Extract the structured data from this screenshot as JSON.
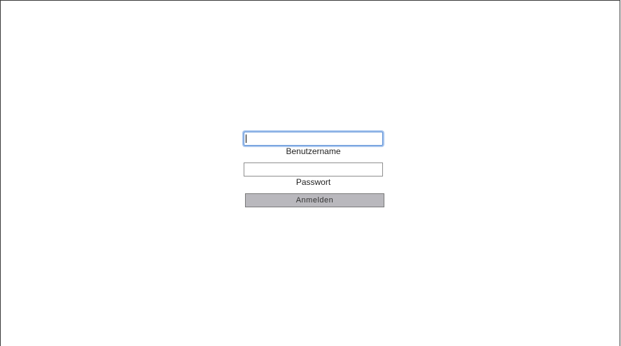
{
  "login": {
    "username": {
      "value": "",
      "label": "Benutzername"
    },
    "password": {
      "value": "",
      "label": "Passwort"
    },
    "submit_label": "Anmelden"
  }
}
